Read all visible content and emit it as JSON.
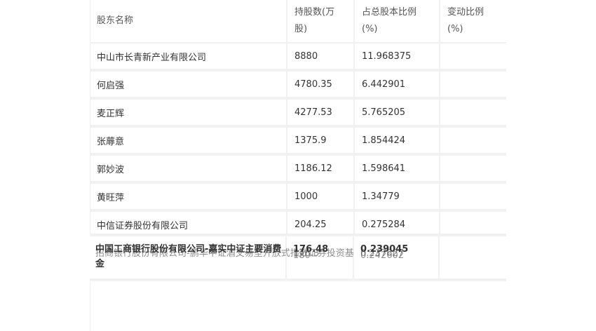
{
  "table": {
    "headers": {
      "name": "股东名称",
      "shares": "持股数(万股)",
      "ratio": "占总股本比例(%)",
      "change": "变动比例(%)"
    },
    "rows": [
      {
        "name": "中山市长青新产业有限公司",
        "shares": "8880",
        "ratio": "11.968375",
        "change": ""
      },
      {
        "name": "何启强",
        "shares": "4780.35",
        "ratio": "6.442901",
        "change": ""
      },
      {
        "name": "麦正辉",
        "shares": "4277.53",
        "ratio": "5.765205",
        "change": ""
      },
      {
        "name": "张蓐意",
        "shares": "1375.9",
        "ratio": "1.854424",
        "change": ""
      },
      {
        "name": "郭妙波",
        "shares": "1186.12",
        "ratio": "1.598641",
        "change": ""
      },
      {
        "name": "黄旺萍",
        "shares": "1000",
        "ratio": "1.34779",
        "change": ""
      },
      {
        "name": "中信证券股份有限公司",
        "shares": "204.25",
        "ratio": "0.275284",
        "change": ""
      }
    ],
    "overlapped": {
      "name_a": "中国工商银行股份有限公司-嘉实中证主要消费",
      "name_b": "招商银行股份有限公司-鹏华中证酒交易型开放式指数证券投资基",
      "name_wrap": "金",
      "shares_a": "176.48",
      "shares_b": "176.3",
      "shares_c": "180",
      "ratio_a": "0.239045",
      "ratio_b": "0.237627",
      "ratio_c": "0.242602"
    }
  }
}
